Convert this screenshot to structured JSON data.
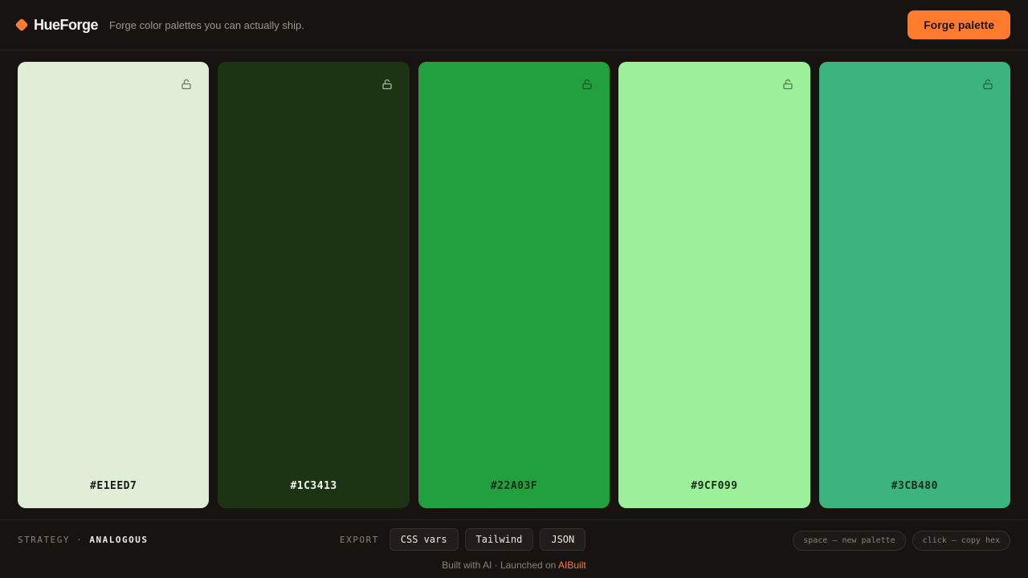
{
  "header": {
    "brand": "HueForge",
    "tagline": "Forge color palettes you can actually ship.",
    "forge_button": "Forge palette",
    "accent_color": "#ff7b2e"
  },
  "swatches": [
    {
      "hex": "#E1EED7",
      "color": "#E1EED7",
      "text_color": "#1a1a1a",
      "lock_icon": "unlock-icon",
      "icon_color": "#6b7566"
    },
    {
      "hex": "#1C3413",
      "color": "#1C3413",
      "text_color": "#f4f4f0",
      "lock_icon": "unlock-icon",
      "icon_color": "#a9b6a2"
    },
    {
      "hex": "#22A03F",
      "color": "#22A03F",
      "text_color": "#0f2a15",
      "lock_icon": "unlock-icon",
      "icon_color": "#145c24"
    },
    {
      "hex": "#9CF099",
      "color": "#9CF099",
      "text_color": "#1a2a1a",
      "lock_icon": "unlock-icon",
      "icon_color": "#4f7c4d"
    },
    {
      "hex": "#3CB480",
      "color": "#3CB480",
      "text_color": "#0f2a1f",
      "lock_icon": "unlock-icon",
      "icon_color": "#1f6648"
    }
  ],
  "bottom": {
    "strategy_label": "STRATEGY",
    "strategy_sep": "·",
    "strategy_value": "ANALOGOUS",
    "export_label": "EXPORT",
    "export_buttons": [
      "CSS vars",
      "Tailwind",
      "JSON"
    ],
    "hints": [
      "space — new palette",
      "click — copy hex"
    ],
    "footer_text": "Built with AI · Launched on ",
    "footer_link": "AIBuilt"
  }
}
